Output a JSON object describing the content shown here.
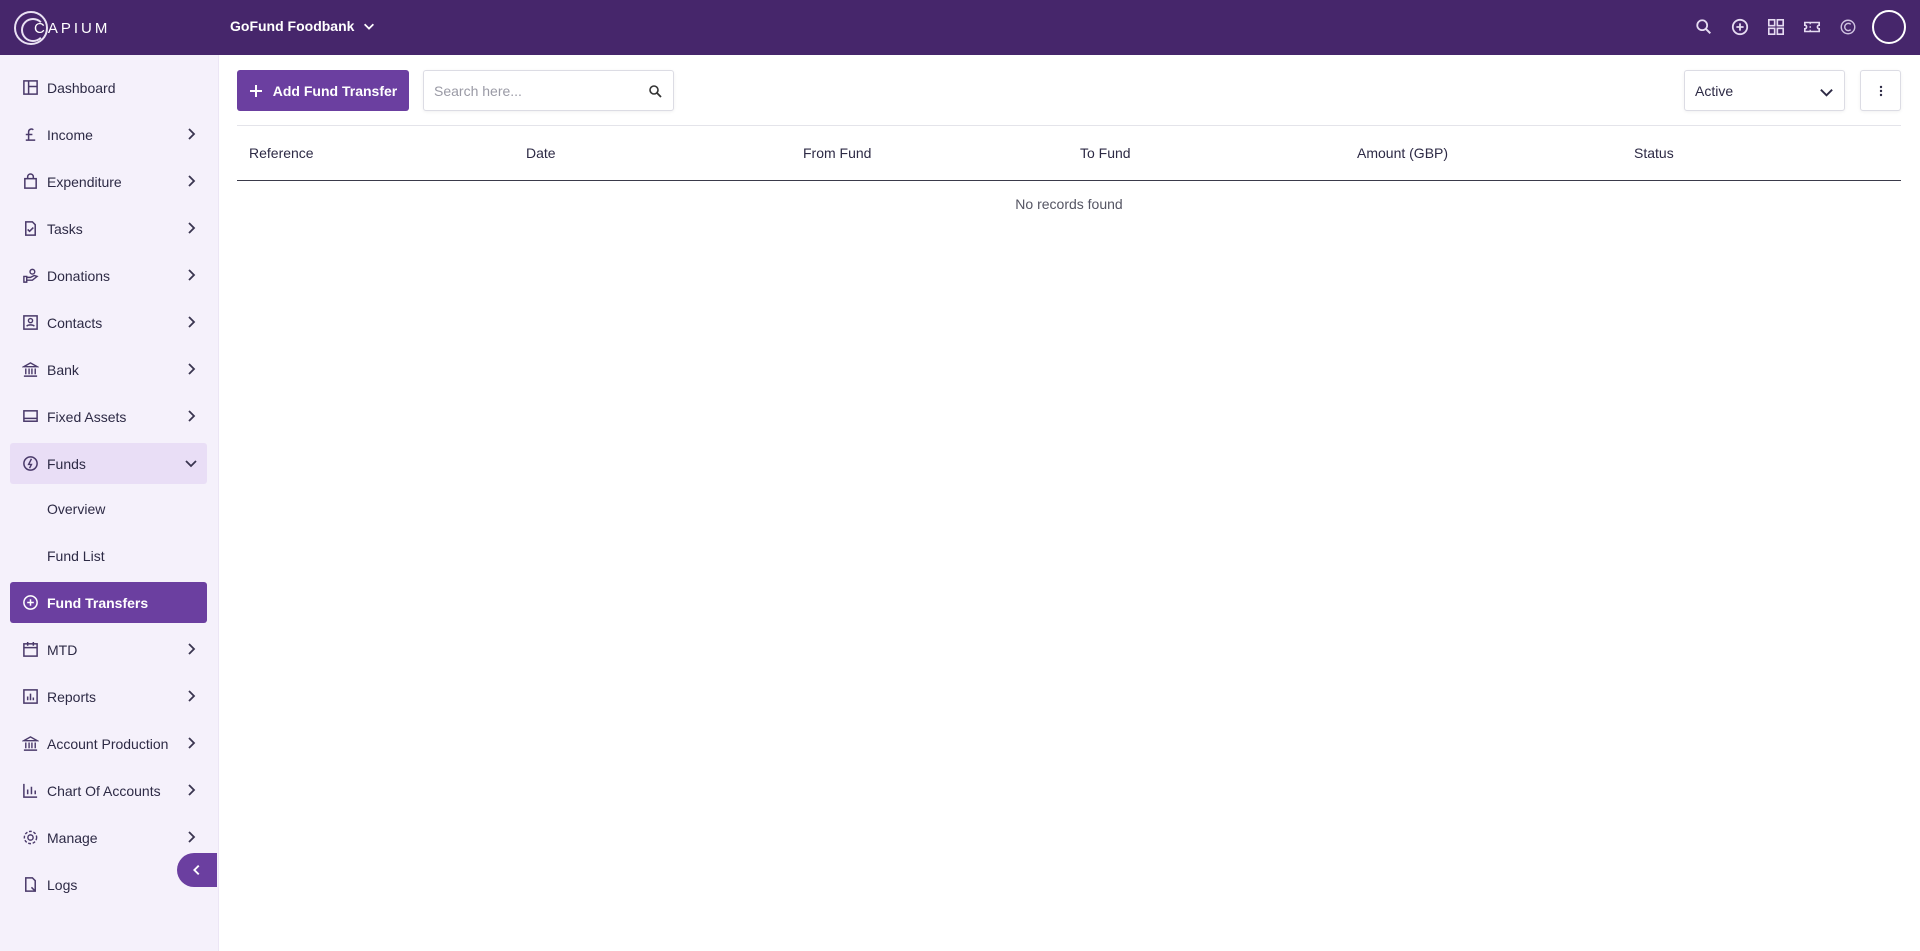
{
  "brand": {
    "logo_text": "CAPIUM"
  },
  "header": {
    "org_name": "GoFund Foodbank",
    "icons": [
      "search-icon",
      "add-circle-icon",
      "apps-grid-icon",
      "ticket-icon",
      "capium-icon",
      "user-avatar"
    ]
  },
  "sidebar": {
    "items": [
      {
        "label": "Dashboard",
        "icon": "dashboard-icon"
      },
      {
        "label": "Income",
        "icon": "pound-icon"
      },
      {
        "label": "Expenditure",
        "icon": "bag-icon"
      },
      {
        "label": "Tasks",
        "icon": "tasks-icon"
      },
      {
        "label": "Donations",
        "icon": "donation-icon"
      },
      {
        "label": "Contacts",
        "icon": "contacts-icon"
      },
      {
        "label": "Bank",
        "icon": "bank-icon"
      },
      {
        "label": "Fixed Assets",
        "icon": "laptop-icon"
      },
      {
        "label": "Funds",
        "icon": "funds-icon"
      },
      {
        "label": "Fund Transfers",
        "icon": "add-circle-icon"
      },
      {
        "label": "MTD",
        "icon": "calendar-icon"
      },
      {
        "label": "Reports",
        "icon": "reports-icon"
      },
      {
        "label": "Account Production",
        "icon": "bank-icon"
      },
      {
        "label": "Chart Of Accounts",
        "icon": "chart-icon"
      },
      {
        "label": "Manage",
        "icon": "gear-icon"
      },
      {
        "label": "Logs",
        "icon": "logs-icon"
      }
    ],
    "funds_sub": {
      "overview": "Overview",
      "fund_list": "Fund List"
    }
  },
  "toolbar": {
    "add_label": "Add Fund Transfer",
    "search_placeholder": "Search here...",
    "status_value": "Active"
  },
  "table": {
    "columns": [
      "Reference",
      "Date",
      "From Fund",
      "To Fund",
      "Amount (GBP)",
      "Status"
    ],
    "empty_text": "No records found"
  },
  "colors": {
    "brand": "#46266b",
    "accent": "#6b3fa0",
    "sidebar_bg": "#f5f1fb"
  }
}
